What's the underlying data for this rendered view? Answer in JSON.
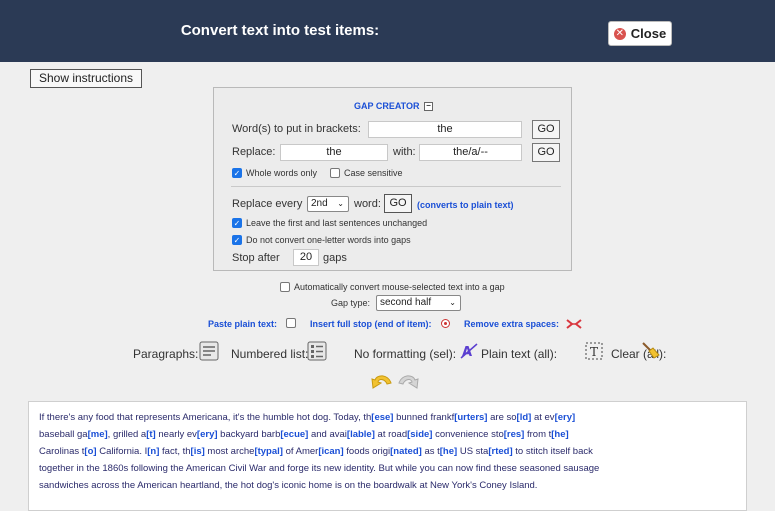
{
  "header": {
    "title": "Convert text into test items:",
    "close_label": "Close"
  },
  "show_instructions_label": "Show instructions",
  "gap_creator": {
    "title": "GAP CREATOR",
    "brackets_label": "Word(s) to put in brackets:",
    "brackets_value": "the",
    "go_label": "GO",
    "replace_label": "Replace:",
    "replace_value": "the",
    "with_label": "with:",
    "with_value": "the/a/--",
    "whole_words_label": "Whole words only",
    "case_sensitive_label": "Case sensitive",
    "replace_every_label": "Replace every",
    "replace_every_value": "2nd",
    "word_label": "word:",
    "converts_label": "(converts to plain text)",
    "leave_first_last_label": "Leave the first and last sentences unchanged",
    "no_one_letter_label": "Do not convert one-letter words into gaps",
    "stop_after_label": "Stop after",
    "stop_after_value": "20",
    "gaps_label": "gaps"
  },
  "auto_convert_label": "Automatically convert mouse-selected text into a gap",
  "gap_type": {
    "label": "Gap type:",
    "value": "second half"
  },
  "options_row": {
    "paste_plain_label": "Paste plain text:",
    "insert_full_stop_label": "Insert full stop (end of item):",
    "remove_spaces_label": "Remove extra spaces:"
  },
  "formatting": {
    "paragraphs_label": "Paragraphs:",
    "numbered_label": "Numbered list:",
    "no_formatting_label": "No formatting (sel):",
    "plain_text_label": "Plain text (all):",
    "clear_label": "Clear (all):"
  },
  "content_lines": [
    [
      {
        "t": "If there's any food that represents Americana, it's the humble hot dog. Today, th"
      },
      {
        "t": "[ese]",
        "gap": true
      },
      {
        "t": " bunned frankf"
      },
      {
        "t": "[urters]",
        "gap": true
      },
      {
        "t": " are so"
      },
      {
        "t": "[ld]",
        "gap": true
      },
      {
        "t": " at ev"
      },
      {
        "t": "[ery]",
        "gap": true
      }
    ],
    [
      {
        "t": "baseball ga"
      },
      {
        "t": "[me]",
        "gap": true
      },
      {
        "t": ", grilled a"
      },
      {
        "t": "[t]",
        "gap": true
      },
      {
        "t": " nearly ev"
      },
      {
        "t": "[ery]",
        "gap": true
      },
      {
        "t": " backyard barb"
      },
      {
        "t": "[ecue]",
        "gap": true
      },
      {
        "t": " and avai"
      },
      {
        "t": "[lable]",
        "gap": true
      },
      {
        "t": " at road"
      },
      {
        "t": "[side]",
        "gap": true
      },
      {
        "t": " convenience sto"
      },
      {
        "t": "[res]",
        "gap": true
      },
      {
        "t": " from t"
      },
      {
        "t": "[he]",
        "gap": true
      }
    ],
    [
      {
        "t": "Carolinas t"
      },
      {
        "t": "[o]",
        "gap": true
      },
      {
        "t": " California. I"
      },
      {
        "t": "[n]",
        "gap": true
      },
      {
        "t": " fact, th"
      },
      {
        "t": "[is]",
        "gap": true
      },
      {
        "t": " most arche"
      },
      {
        "t": "[typal]",
        "gap": true
      },
      {
        "t": " of Amer"
      },
      {
        "t": "[ican]",
        "gap": true
      },
      {
        "t": " foods origi"
      },
      {
        "t": "[nated]",
        "gap": true
      },
      {
        "t": " as t"
      },
      {
        "t": "[he]",
        "gap": true
      },
      {
        "t": " US sta"
      },
      {
        "t": "[rted]",
        "gap": true
      },
      {
        "t": " to stitch itself back"
      }
    ],
    [
      {
        "t": "together in the 1860s following the American Civil War and forge its new identity. But while you can now find these seasoned sausage"
      }
    ],
    [
      {
        "t": "sandwiches across the American heartland, the hot dog's iconic home is on the boardwalk at New York's Coney Island."
      }
    ]
  ]
}
